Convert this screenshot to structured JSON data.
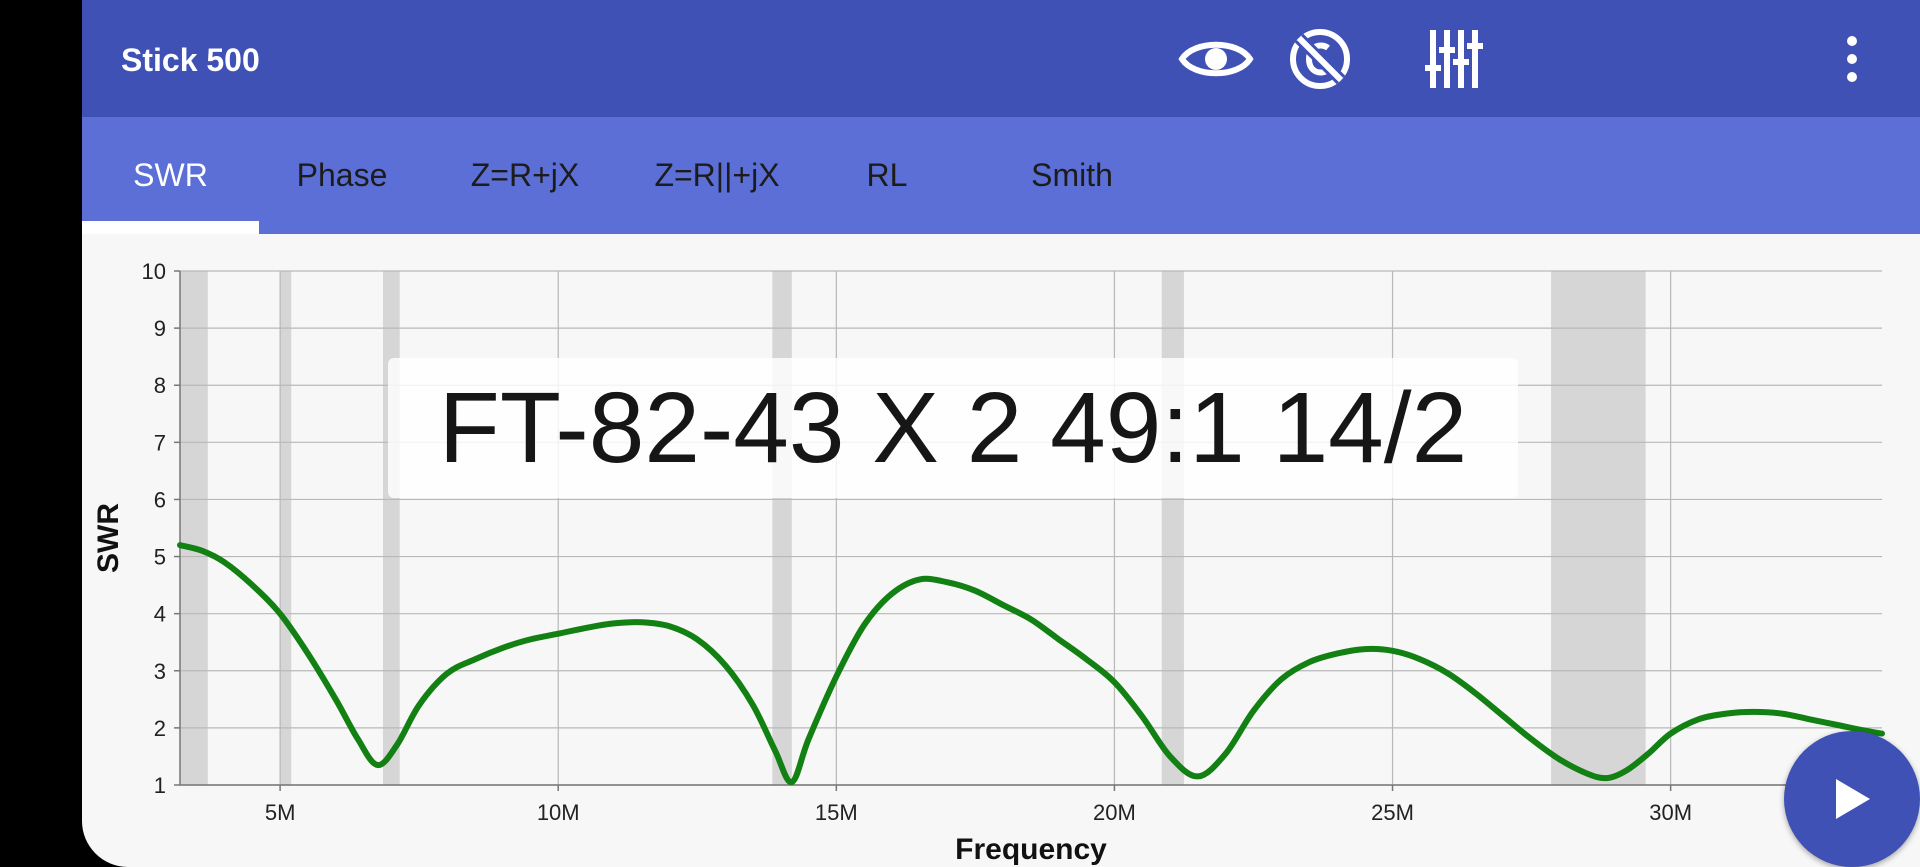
{
  "appbar": {
    "title": "Stick 500",
    "icons": [
      "eye-icon",
      "no-calibration-icon",
      "sliders-icon",
      "more-vert-icon"
    ]
  },
  "tabs": [
    {
      "label": "SWR",
      "active": true
    },
    {
      "label": "Phase",
      "active": false
    },
    {
      "label": "Z=R+jX",
      "active": false
    },
    {
      "label": "Z=R||+jX",
      "active": false
    },
    {
      "label": "RL",
      "active": false
    },
    {
      "label": "Smith",
      "active": false
    }
  ],
  "fab": {
    "icon": "play-icon"
  },
  "colors": {
    "appbar": "#3f51b5",
    "tabbar": "#5b6fd6",
    "curve": "#128012",
    "band_shade": "#d6d6d6"
  },
  "chart_data": {
    "type": "line",
    "title": "FT-82-43 X 2 49:1 14/2",
    "xlabel": "Frequency",
    "ylabel": "SWR",
    "xlim": [
      3.2,
      33.8
    ],
    "ylim": [
      1,
      10
    ],
    "x_ticks": [
      "5M",
      "10M",
      "15M",
      "20M",
      "25M",
      "30M"
    ],
    "x_tick_values": [
      5,
      10,
      15,
      20,
      25,
      30
    ],
    "y_ticks": [
      "1",
      "2",
      "3",
      "4",
      "5",
      "6",
      "7",
      "8",
      "9",
      "10"
    ],
    "grid": true,
    "ham_bands_mhz": [
      [
        3.2,
        3.7
      ],
      [
        5.0,
        5.2
      ],
      [
        6.85,
        7.15
      ],
      [
        13.85,
        14.2
      ],
      [
        20.85,
        21.25
      ],
      [
        27.85,
        29.55
      ]
    ],
    "series": [
      {
        "x": [
          3.2,
          3.6,
          4.0,
          4.5,
          5.0,
          5.5,
          6.0,
          6.4,
          6.75,
          7.1,
          7.5,
          8.0,
          8.5,
          9.0,
          9.5,
          10.0,
          10.5,
          11.0,
          11.5,
          12.0,
          12.5,
          13.0,
          13.5,
          13.9,
          14.2,
          14.5,
          15.0,
          15.5,
          16.0,
          16.5,
          17.0,
          17.5,
          18.0,
          18.5,
          19.0,
          19.5,
          20.0,
          20.5,
          21.0,
          21.5,
          22.0,
          22.5,
          23.0,
          23.5,
          24.0,
          24.5,
          25.0,
          25.5,
          26.0,
          26.5,
          27.0,
          27.5,
          28.0,
          28.5,
          28.85,
          29.2,
          29.6,
          30.0,
          30.5,
          31.0,
          31.5,
          32.0,
          32.5,
          33.0,
          33.5,
          33.8
        ],
        "y": [
          5.2,
          5.1,
          4.9,
          4.5,
          4.0,
          3.3,
          2.5,
          1.8,
          1.35,
          1.7,
          2.4,
          2.95,
          3.2,
          3.4,
          3.55,
          3.65,
          3.75,
          3.83,
          3.85,
          3.78,
          3.55,
          3.1,
          2.4,
          1.6,
          1.05,
          1.8,
          2.9,
          3.8,
          4.35,
          4.6,
          4.55,
          4.4,
          4.15,
          3.9,
          3.55,
          3.2,
          2.8,
          2.2,
          1.5,
          1.15,
          1.55,
          2.3,
          2.85,
          3.15,
          3.3,
          3.38,
          3.35,
          3.2,
          2.95,
          2.6,
          2.2,
          1.8,
          1.45,
          1.2,
          1.12,
          1.25,
          1.55,
          1.9,
          2.15,
          2.25,
          2.28,
          2.25,
          2.15,
          2.05,
          1.95,
          1.9
        ]
      }
    ]
  }
}
